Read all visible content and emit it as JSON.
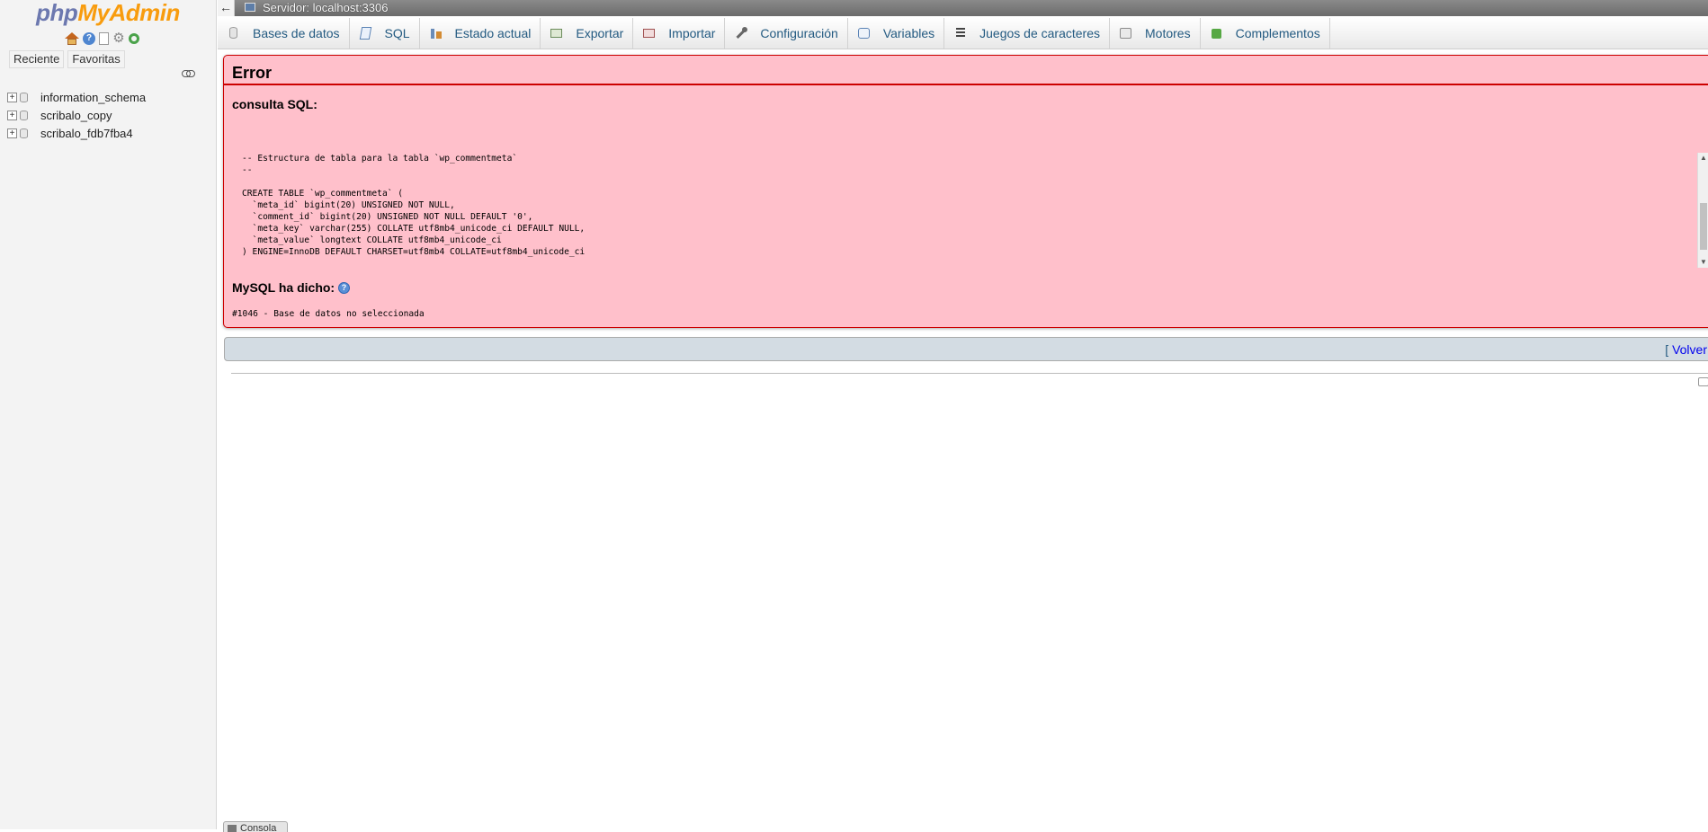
{
  "nav": {
    "logo_php": "php",
    "logo_myadmin": "MyAdmin",
    "icons": [
      "home-icon",
      "help-icon",
      "documentation-icon",
      "settings-icon",
      "reload-icon"
    ],
    "tabs": {
      "recent": "Reciente",
      "favorites": "Favoritas"
    },
    "databases": [
      {
        "name": "information_schema"
      },
      {
        "name": "scribalo_copy"
      },
      {
        "name": "scribalo_fdb7fba4"
      }
    ]
  },
  "serverbar": {
    "label": "Servidor: localhost:3306"
  },
  "menu": [
    {
      "label": "Bases de datos",
      "icon": "database-icon"
    },
    {
      "label": "SQL",
      "icon": "sql-icon"
    },
    {
      "label": "Estado actual",
      "icon": "status-icon"
    },
    {
      "label": "Exportar",
      "icon": "export-icon"
    },
    {
      "label": "Importar",
      "icon": "import-icon"
    },
    {
      "label": "Configuración",
      "icon": "wrench-icon"
    },
    {
      "label": "Variables",
      "icon": "variables-icon"
    },
    {
      "label": "Juegos de caracteres",
      "icon": "charset-icon"
    },
    {
      "label": "Motores",
      "icon": "engines-icon"
    },
    {
      "label": "Complementos",
      "icon": "plugins-icon"
    }
  ],
  "error": {
    "title": "Error",
    "sql_heading": "consulta SQL:",
    "sql_code": "-- Estructura de tabla para la tabla `wp_commentmeta`\n--\n\nCREATE TABLE `wp_commentmeta` (\n  `meta_id` bigint(20) UNSIGNED NOT NULL,\n  `comment_id` bigint(20) UNSIGNED NOT NULL DEFAULT '0',\n  `meta_key` varchar(255) COLLATE utf8mb4_unicode_ci DEFAULT NULL,\n  `meta_value` longtext COLLATE utf8mb4_unicode_ci\n) ENGINE=InnoDB DEFAULT CHARSET=utf8mb4 COLLATE=utf8mb4_unicode_ci",
    "mysql_said": "MySQL ha dicho:",
    "mysql_message": "#1046 - Base de datos no seleccionada"
  },
  "volver": {
    "bracket_open": "[ ",
    "label": "Volver"
  },
  "console": {
    "label": "Consola"
  },
  "colors": {
    "error_bg": "#ffc0cb",
    "error_border": "#cc0000",
    "link": "#235a81",
    "logo_php": "#6c78af",
    "logo_myadmin": "#f89c0e"
  }
}
